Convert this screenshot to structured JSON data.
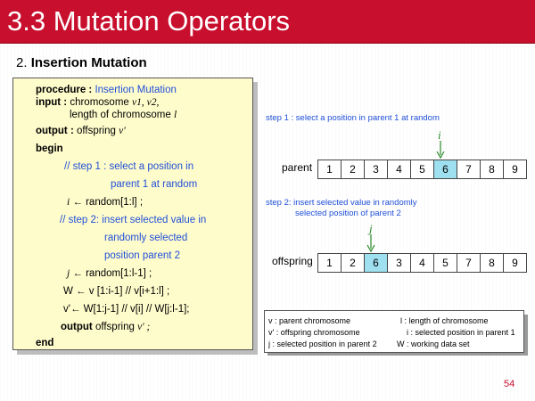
{
  "title": "3.3 Mutation Operators",
  "subtitle": {
    "number": "2.",
    "text": "Insertion Mutation"
  },
  "procedure": {
    "procedure_kw": "procedure :",
    "procedure_name": "Insertion Mutation",
    "input_kw": "input :",
    "input_line1_text": "chromosome ",
    "input_line1_vars": "v1, v2,",
    "input_line2_text": "length of chromosome ",
    "input_line2_var": "l",
    "output_kw": "output :",
    "output_text": "offspring ",
    "output_var": "v'",
    "begin": "begin",
    "comment1_line1": "// step 1 : select a position in",
    "comment1_line2": "parent 1 at random",
    "assign_i_var": "i",
    "assign_i_text": "← random[1:l] ;",
    "comment2_line1": "// step 2: insert selected value in",
    "comment2_line2": "randomly selected",
    "comment2_line3": "position parent 2",
    "assign_j_var": "j",
    "assign_j_text": "← random[1:l-1] ;",
    "assign_W": "W ← v [1:i-1] // v[i+1:l] ;",
    "assign_v": "v'← W[1:j-1] // v[i] // W[j:l-1];",
    "output_stmt_kw": "output",
    "output_stmt_text": "offspring",
    "output_stmt_var": "v' ;",
    "end": "end"
  },
  "step1_label": "step 1 : select a position in parent 1 at random",
  "step2_line1": "step 2: insert selected value in randomly",
  "step2_line2": "selected position of parent 2",
  "marker_i": "i",
  "marker_j": "j",
  "parent": {
    "label": "parent",
    "cells": [
      "1",
      "2",
      "3",
      "4",
      "5",
      "6",
      "7",
      "8",
      "9"
    ],
    "highlight_index": 5
  },
  "offspring": {
    "label": "offspring",
    "cells": [
      "1",
      "2",
      "6",
      "3",
      "4",
      "5",
      "7",
      "8",
      "9"
    ],
    "highlight_index": 2
  },
  "legend": {
    "v": "v : parent chromosome",
    "l": "l : length of chromosome",
    "vp": "v' : offspring chromosome",
    "i": "i : selected position in parent 1",
    "j": "j : selected position in parent 2",
    "W": "W : working data set"
  },
  "page_number": "54",
  "colors": {
    "title_bar": "#c8102e",
    "highlight": "#9fe0f0",
    "procedure_bg": "#fffccc",
    "accent_blue": "#1f4fd8",
    "marker_green": "#2a8a2a"
  }
}
